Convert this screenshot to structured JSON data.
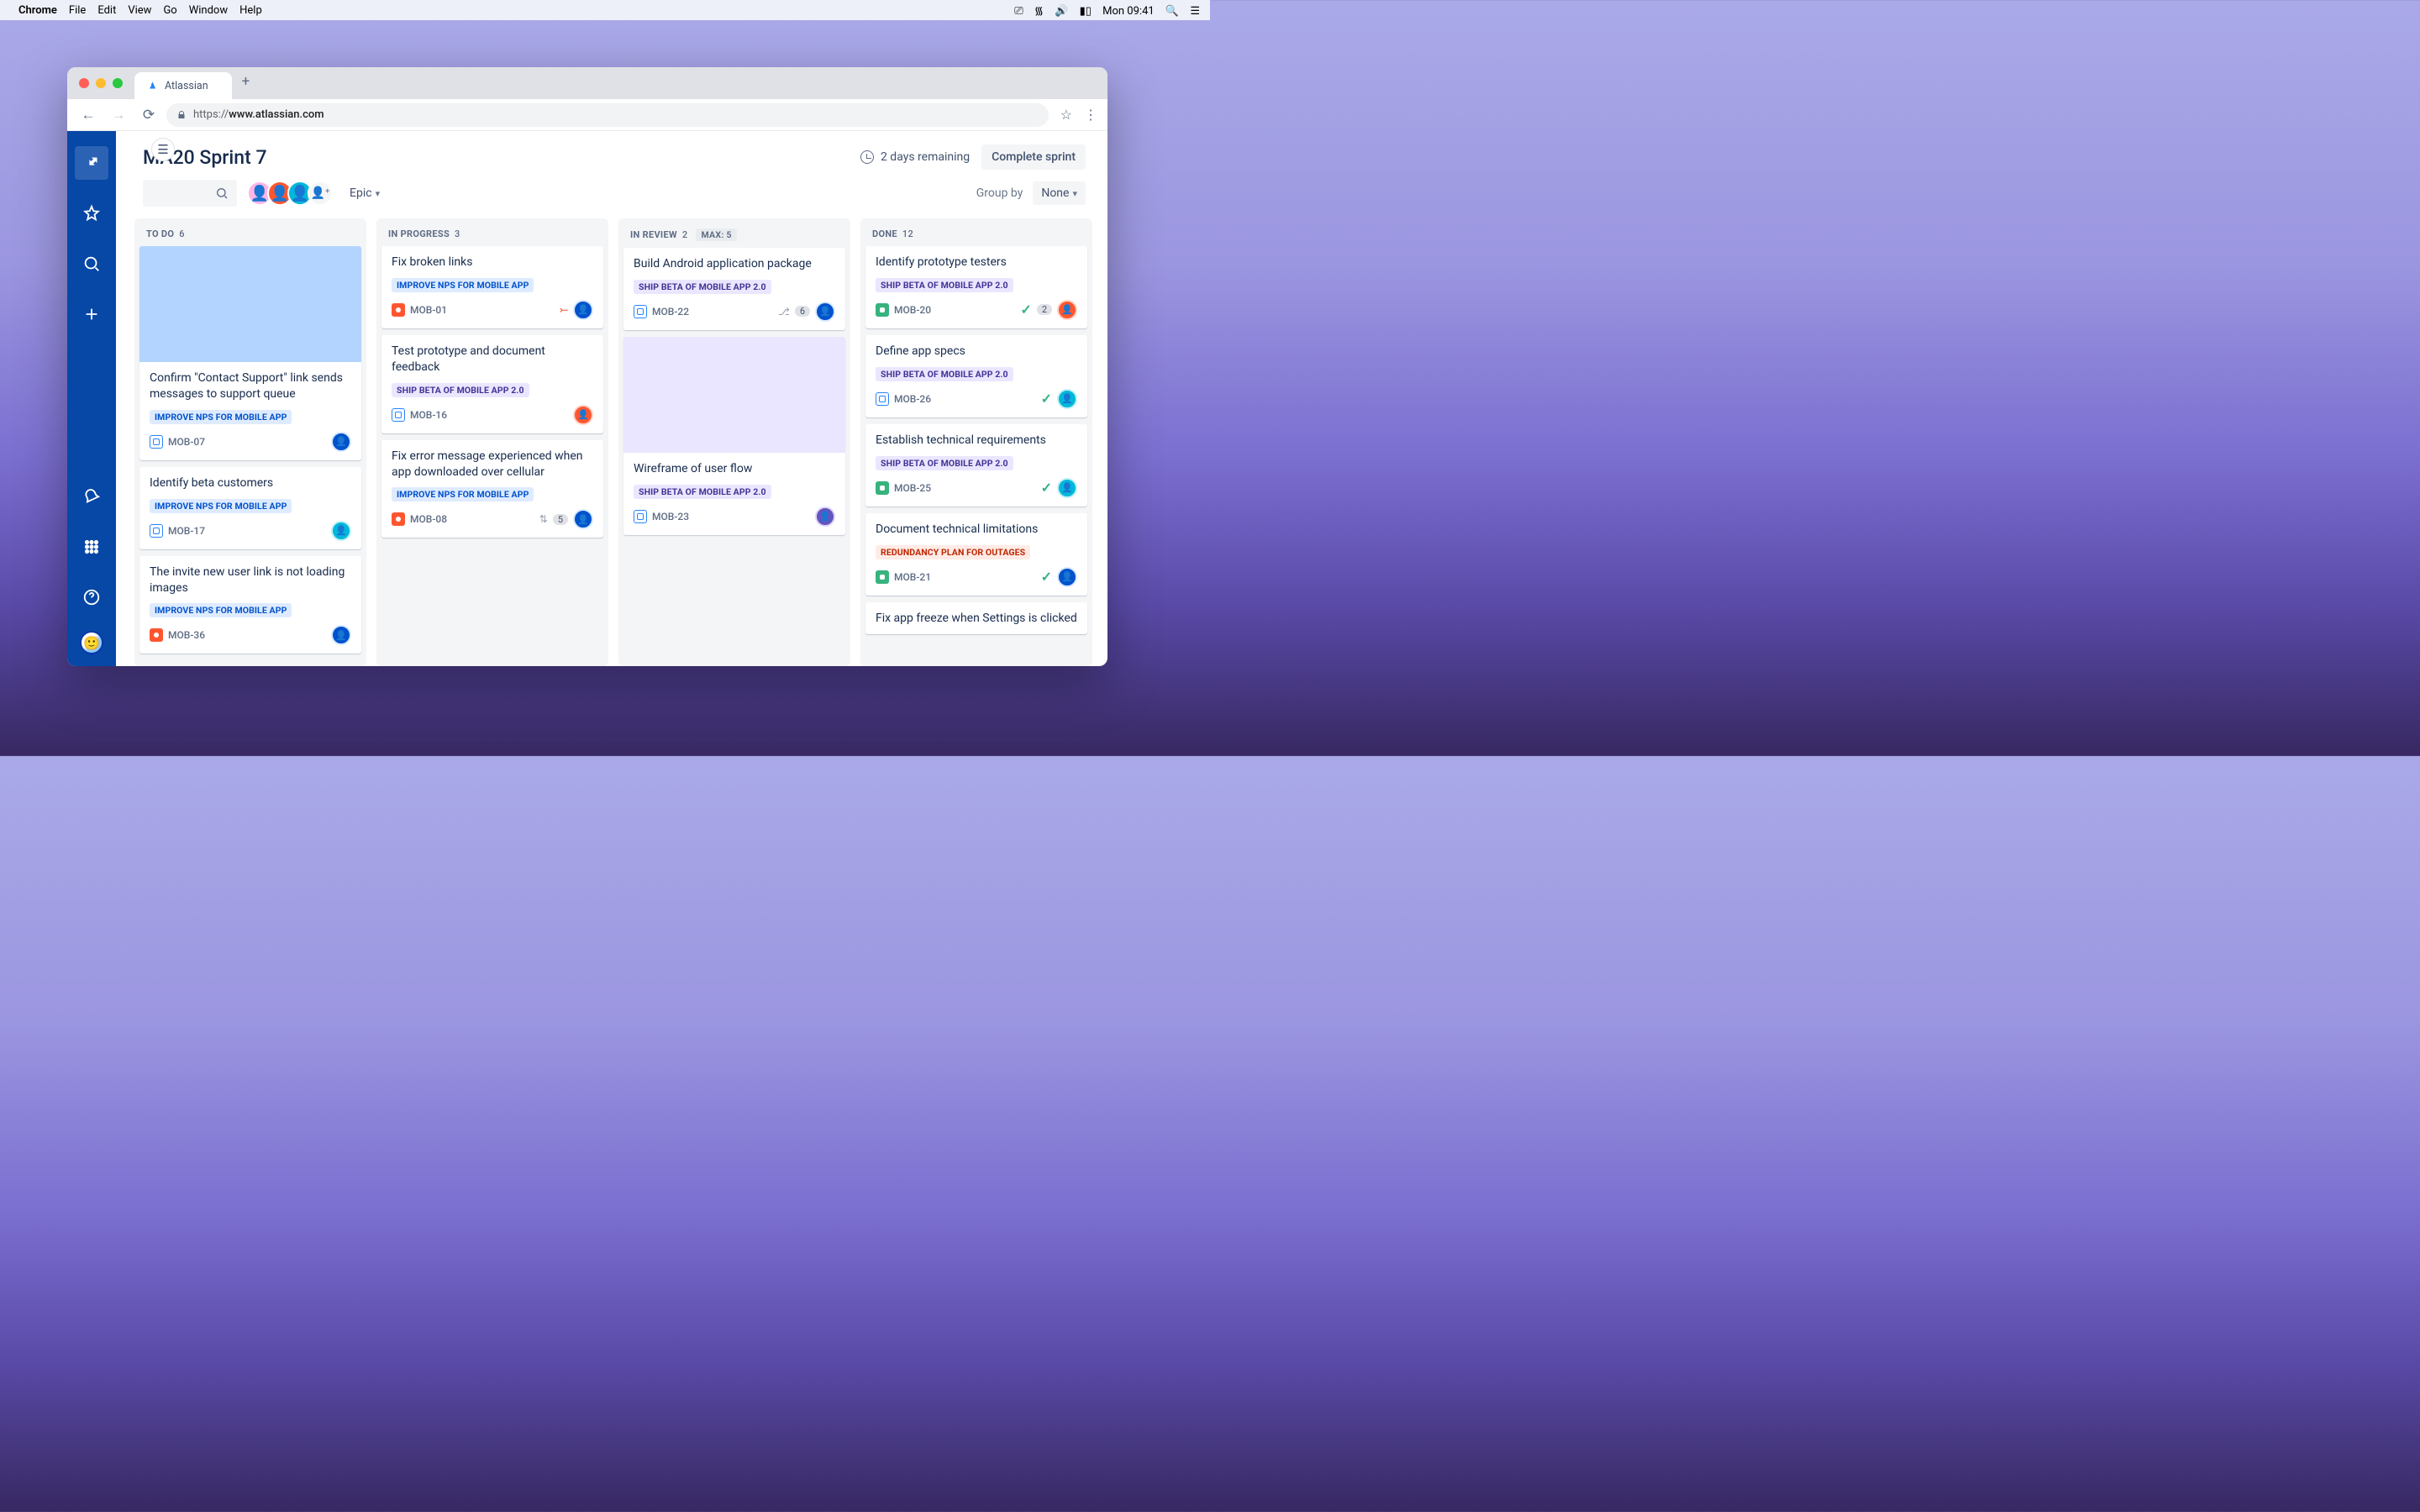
{
  "menubar": {
    "app": "Chrome",
    "items": [
      "File",
      "Edit",
      "View",
      "Go",
      "Window",
      "Help"
    ],
    "clock": "Mon 09:41"
  },
  "browser": {
    "tab_title": "Atlassian",
    "url_prefix": "https://",
    "url_host": "www.atlassian.com"
  },
  "sidebar": {
    "items": [
      "jira",
      "star",
      "search",
      "add"
    ],
    "bottom": [
      "notifications",
      "apps",
      "help",
      "profile"
    ]
  },
  "header": {
    "title": "MA20 Sprint 7",
    "remaining": "2 days remaining",
    "complete": "Complete sprint"
  },
  "controls": {
    "epic": "Epic",
    "group_by": "Group by",
    "group_val": "None"
  },
  "epics": {
    "nps": "IMPROVE NPS FOR MOBILE APP",
    "beta": "SHIP BETA OF MOBILE APP 2.0",
    "outage": "REDUNDANCY PLAN FOR OUTAGES"
  },
  "columns": [
    {
      "name": "TO DO",
      "count": 6,
      "max": null,
      "cards": [
        {
          "cover": "blue",
          "title": "Confirm \"Contact Support\" link sends messages to support queue",
          "epic": "nps",
          "type": "task",
          "key": "MOB-07",
          "avatar": "av1"
        },
        {
          "title": "Identify beta customers",
          "epic": "nps",
          "type": "task",
          "key": "MOB-17",
          "avatar": "av3"
        },
        {
          "title": "The invite new user link is not loading images",
          "epic": "nps",
          "type": "bug",
          "key": "MOB-36",
          "avatar": "av1"
        }
      ]
    },
    {
      "name": "IN PROGRESS",
      "count": 3,
      "max": null,
      "cards": [
        {
          "title": "Fix broken links",
          "epic": "nps",
          "type": "bug",
          "key": "MOB-01",
          "pr": true,
          "avatar": "av1"
        },
        {
          "title": "Test prototype and document feedback",
          "epic": "beta",
          "type": "task",
          "key": "MOB-16",
          "avatar": "av2"
        },
        {
          "title": "Fix error message experienced when app downloaded over cellular",
          "epic": "nps",
          "type": "bug",
          "key": "MOB-08",
          "priority": true,
          "num": "5",
          "avatar": "av1"
        }
      ]
    },
    {
      "name": "IN REVIEW",
      "count": 2,
      "max": "MAX: 5",
      "cards": [
        {
          "title": "Build Android application package",
          "epic": "beta",
          "type": "task",
          "key": "MOB-22",
          "branch": true,
          "num": "6",
          "avatar": "av1"
        },
        {
          "cover": "lilac",
          "title": "Wireframe of user flow",
          "epic": "beta",
          "type": "task",
          "key": "MOB-23",
          "avatar": "av4"
        }
      ]
    },
    {
      "name": "DONE",
      "count": 12,
      "max": null,
      "cards": [
        {
          "title": "Identify prototype testers",
          "epic": "beta",
          "type": "story",
          "key": "MOB-20",
          "check": true,
          "num": "2",
          "avatar": "av2"
        },
        {
          "title": "Define app specs",
          "epic": "beta",
          "type": "task",
          "key": "MOB-26",
          "check": true,
          "avatar": "av3"
        },
        {
          "title": "Establish technical requirements",
          "epic": "beta",
          "type": "story",
          "key": "MOB-25",
          "check": true,
          "avatar": "av3"
        },
        {
          "title": "Document technical limitations",
          "epic": "outage",
          "type": "story",
          "key": "MOB-21",
          "check": true,
          "avatar": "av1"
        },
        {
          "title": "Fix app freeze when Settings is clicked"
        }
      ]
    }
  ]
}
